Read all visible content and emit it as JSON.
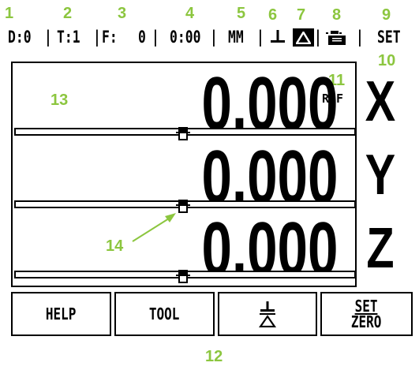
{
  "callout_color": "#8cc63f",
  "callouts": {
    "c1": "1",
    "c2": "2",
    "c3": "3",
    "c4": "4",
    "c5": "5",
    "c6": "6",
    "c7": "7",
    "c8": "8",
    "c9": "9",
    "c10": "10",
    "c11": "11",
    "c12": "12",
    "c13": "13",
    "c14": "14"
  },
  "status_bar": {
    "datum": "D:0",
    "tool": "T:1",
    "feed_label": "F:",
    "feed_value": "0",
    "timer": "0:00",
    "units": "MM",
    "reference_mode_icon": "mode-down-arrow-icon",
    "incremental_icon": "delta-icon",
    "setup_icon": "setup-icon",
    "set_label": "SET"
  },
  "display": {
    "ref_label": "REF",
    "axes": [
      {
        "value": "0.000",
        "label": "X"
      },
      {
        "value": "0.000",
        "label": "Y"
      },
      {
        "value": "0.000",
        "label": "Z"
      }
    ]
  },
  "softkeys": {
    "help": "HELP",
    "tool": "TOOL",
    "set_top": "SET",
    "set_bottom": "ZERO"
  }
}
